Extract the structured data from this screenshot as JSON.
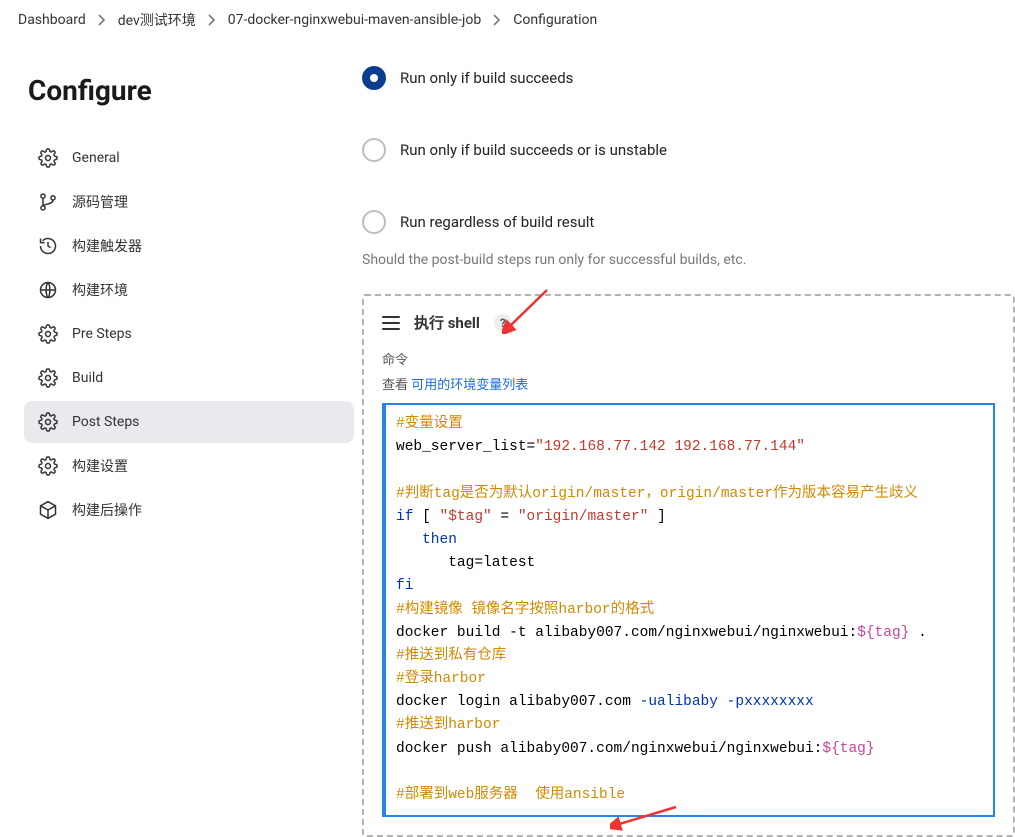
{
  "breadcrumb": {
    "items": [
      "Dashboard",
      "dev测试环境",
      "07-docker-nginxwebui-maven-ansible-job",
      "Configuration"
    ]
  },
  "page_title": "Configure",
  "sidebar": {
    "items": [
      {
        "label": "General",
        "icon": "gear"
      },
      {
        "label": "源码管理",
        "icon": "branch"
      },
      {
        "label": "构建触发器",
        "icon": "clock-arrow"
      },
      {
        "label": "构建环境",
        "icon": "globe"
      },
      {
        "label": "Pre Steps",
        "icon": "gear"
      },
      {
        "label": "Build",
        "icon": "gear"
      },
      {
        "label": "Post Steps",
        "icon": "gear",
        "active": true
      },
      {
        "label": "构建设置",
        "icon": "gear"
      },
      {
        "label": "构建后操作",
        "icon": "cube"
      }
    ]
  },
  "radios": {
    "opt1": "Run only if build succeeds",
    "opt2": "Run only if build succeeds or is unstable",
    "opt3": "Run regardless of build result",
    "selected": 0
  },
  "help_text": "Should the post-build steps run only for successful builds, etc.",
  "shell_step": {
    "title": "执行 shell",
    "help": "?",
    "cmd_label": "命令",
    "env_prefix": "查看",
    "env_link": "可用的环境变量列表",
    "code": {
      "l1": "#变量设置",
      "l2a": "web_server_list=",
      "l2b": "\"192.168.77.142 192.168.77.144\"",
      "l3": "#判断tag是否为默认origin/master，origin/master作为版本容易产生歧义",
      "l4a": "if",
      "l4b": " [ ",
      "l4c": "\"$tag\"",
      "l4d": " = ",
      "l4e": "\"origin/master\"",
      "l4f": " ]",
      "l5": "   then",
      "l6": "      tag=latest",
      "l7": "fi",
      "l8": "#构建镜像 镜像名字按照harbor的格式",
      "l9a": "docker build -t alibaby007.com/nginxwebui/nginxwebui:",
      "l9b": "${tag}",
      "l9c": " .",
      "l10": "#推送到私有仓库",
      "l11": "#登录harbor",
      "l12a": "docker login alibaby007.com ",
      "l12b": "-ualibaby",
      "l12c": " ",
      "l12d": "-pxxxxxxxx",
      "l13": "#推送到harbor",
      "l14a": "docker push alibaby007.com/nginxwebui/nginxwebui:",
      "l14b": "${tag}",
      "l15": "#部署到web服务器  使用ansible"
    }
  }
}
